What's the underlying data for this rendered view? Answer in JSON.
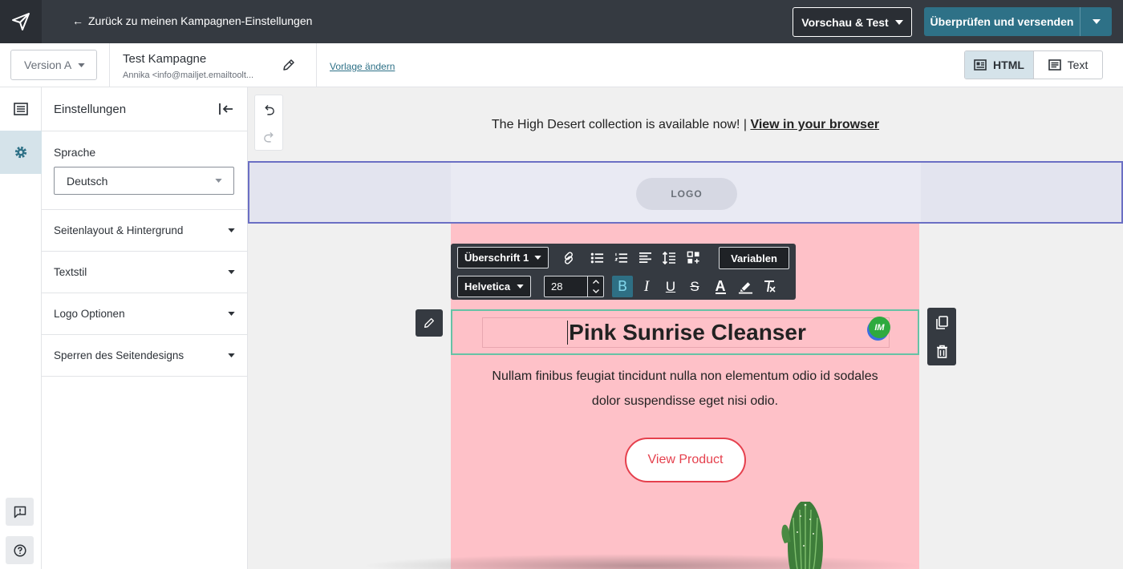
{
  "topbar": {
    "back_label": "Zurück zu meinen Kampagnen-Einstellungen",
    "preview_label": "Vorschau & Test",
    "send_label": "Überprüfen und versenden"
  },
  "subbar": {
    "version_label": "Version A",
    "campaign_name": "Test Kampagne",
    "campaign_from": "Annika <info@mailjet.emailtoolt...",
    "change_template": "Vorlage ändern",
    "mode_html": "HTML",
    "mode_text": "Text"
  },
  "panel": {
    "title": "Einstellungen",
    "language_label": "Sprache",
    "language_value": "Deutsch",
    "sections": [
      "Seitenlayout & Hintergrund",
      "Textstil",
      "Logo Optionen",
      "Sperren des Seitendesigns"
    ]
  },
  "toolbar": {
    "block_style": "Überschrift 1",
    "font": "Helvetica",
    "font_size": "28",
    "variables": "Variablen"
  },
  "email": {
    "preheader": "The High Desert collection is available now! | ",
    "preheader_link": "View in your browser",
    "logo_placeholder": "LOGO",
    "headline": "Pink Sunrise Cleanser",
    "badge": "IM",
    "body": "Nullam finibus feugiat tincidunt nulla non elementum odio id sodales dolor suspendisse eget nisi odio.",
    "cta": "View Product"
  },
  "colors": {
    "topbar": "#353a41",
    "accent": "#2e7187",
    "email_bg": "#fec1c8",
    "cta": "#e5404d",
    "selection": "#6b6fc4",
    "block_selected": "#66c2a5"
  }
}
